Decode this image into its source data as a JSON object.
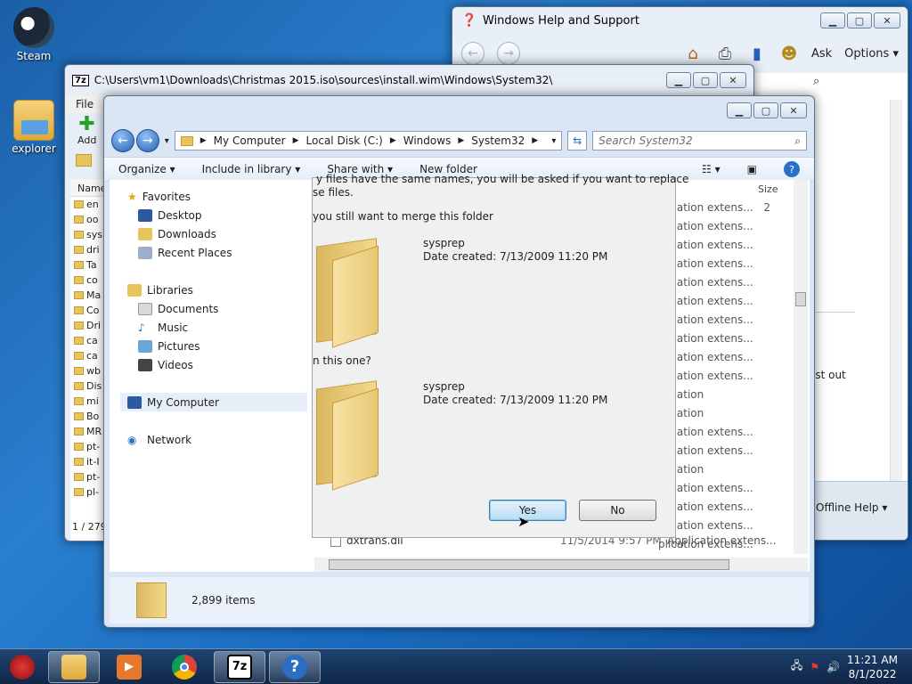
{
  "desktop": {
    "icons": [
      {
        "label": "Steam"
      },
      {
        "label": "explorer"
      }
    ]
  },
  "help_window": {
    "title": "Windows Help and Support",
    "ask_label": "Ask",
    "options_label": "Options",
    "side_text": "ost out",
    "offline_help_label": "Offline Help"
  },
  "zip_window": {
    "title": "C:\\Users\\vm1\\Downloads\\Christmas 2015.iso\\sources\\install.wim\\Windows\\System32\\",
    "menu_file": "File",
    "add_label": "Add",
    "name_header": "Name",
    "rows": [
      "en",
      "oo",
      "sys",
      "dri",
      "Ta",
      "co",
      "Ma",
      "Co",
      "Dri",
      "ca",
      "ca",
      "wb",
      "Dis",
      "mi",
      "Bo",
      "MR",
      "pt-",
      "it-I",
      "pt-",
      "pl-"
    ],
    "status": "1 / 279"
  },
  "explorer": {
    "breadcrumb": [
      "My Computer",
      "Local Disk (C:)",
      "Windows",
      "System32"
    ],
    "search_placeholder": "Search System32",
    "commands": {
      "organize": "Organize",
      "include": "Include in library",
      "share": "Share with",
      "new_folder": "New folder"
    },
    "nav": {
      "favorites": "Favorites",
      "desktop": "Desktop",
      "downloads": "Downloads",
      "recent": "Recent Places",
      "libraries": "Libraries",
      "documents": "Documents",
      "music": "Music",
      "pictures": "Pictures",
      "videos": "Videos",
      "my_computer": "My Computer",
      "network": "Network"
    },
    "columns": {
      "type": "ype",
      "size": "Size"
    },
    "file_types": [
      "plication extens...",
      "plication extens...",
      "plication extens...",
      "plication extens...",
      "plication extens...",
      "plication extens...",
      "plication extens...",
      "plication extens...",
      "plication extens...",
      "plication extens...",
      "plication",
      "plication",
      "plication extens...",
      "plication extens...",
      "plication",
      "plication extens...",
      "plication extens...",
      "plication extens...",
      "plication extens..."
    ],
    "first_size": "2",
    "bottom_file": {
      "name": "dxtrans.dll",
      "date": "11/5/2014 9:57 PM",
      "type": "Application extens..."
    },
    "item_count": "2,899 items"
  },
  "dialog": {
    "line1": "y files have the same names, you will be asked if you want to replace",
    "line2": "se files.",
    "line3": "you still want to merge this folder",
    "folder1_name": "sysprep",
    "folder1_date": "Date created: 7/13/2009 11:20 PM",
    "line4": "n this one?",
    "folder2_name": "sysprep",
    "folder2_date": "Date created: 7/13/2009 11:20 PM",
    "yes_label": "Yes",
    "no_label": "No"
  },
  "taskbar": {
    "time": "11:21 AM",
    "date": "8/1/2022",
    "zip_label": "7z"
  }
}
